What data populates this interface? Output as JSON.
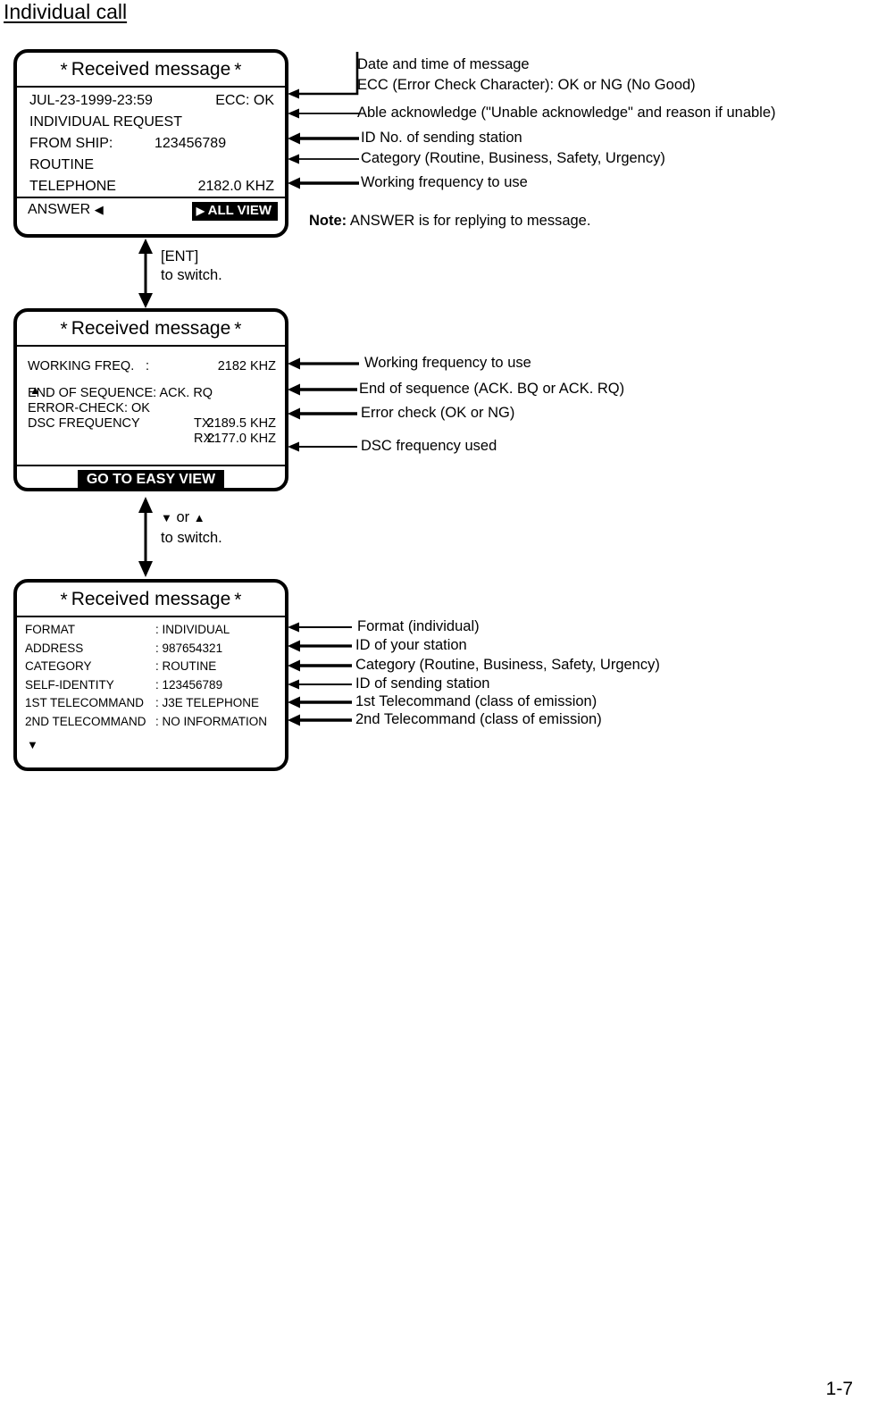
{
  "page": {
    "title": "Individual call",
    "number": "1-7"
  },
  "panels": [
    {
      "id": "easy-view",
      "title_left_star": "*",
      "title": "Received message",
      "title_right_star": "*",
      "rows": [
        {
          "left": "JUL-23-1999-23:59",
          "right": "ECC: OK"
        },
        {
          "left": "INDIVIDUAL REQUEST",
          "right": ""
        },
        {
          "left": "FROM SHIP:",
          "mid": "123456789"
        },
        {
          "left": "ROUTINE",
          "right": ""
        },
        {
          "left": "TELEPHONE",
          "right": "2182.0 KHZ"
        }
      ],
      "footer": {
        "answer_label": "ANSWER",
        "answer_arrow": "◀",
        "allview_arrow": "▶",
        "allview_label": "ALL VIEW"
      }
    },
    {
      "id": "all-view-page1",
      "title_left_star": "*",
      "title": "Received message",
      "title_right_star": "*",
      "scroll_up_indicator": "▲",
      "lines": [
        {
          "label": "WORKING FREQ.",
          "colon": ":",
          "value": "2182 KHZ"
        },
        {
          "label": "END OF SEQUENCE: ACK. RQ"
        },
        {
          "label": "ERROR-CHECK: OK"
        },
        {
          "label": "DSC FREQUENCY",
          "tx_label": "TX:",
          "tx_value": "2189.5 KHZ"
        },
        {
          "rx_label": "RX:",
          "rx_value": "2177.0 KHZ"
        }
      ],
      "footer": {
        "easyview_label": "GO TO EASY VIEW"
      }
    },
    {
      "id": "all-view-page2",
      "title_left_star": "*",
      "title": "Received message",
      "title_right_star": "*",
      "scroll_down_indicator": "▼",
      "lines": [
        {
          "label": "FORMAT",
          "value": ": INDIVIDUAL"
        },
        {
          "label": "ADDRESS",
          "value": ": 987654321"
        },
        {
          "label": "CATEGORY",
          "value": ": ROUTINE"
        },
        {
          "label": "SELF-IDENTITY",
          "value": ": 123456789"
        },
        {
          "label": "1ST TELECOMMAND",
          "value": ": J3E TELEPHONE"
        },
        {
          "label": "2ND TELECOMMAND",
          "value": ": NO INFORMATION"
        }
      ]
    }
  ],
  "connectors": [
    {
      "key_line1": "[ENT]",
      "key_line2": "to switch."
    },
    {
      "key_down": "▼",
      "key_or": "or",
      "key_up": "▲",
      "key_line2": "to switch."
    }
  ],
  "annotations": {
    "panel1": [
      "Date and time of message",
      "ECC (Error Check Character): OK or NG (No Good)",
      "Able acknowledge (\"Unable acknowledge\" and reason if unable)",
      "ID No. of sending station",
      "Category (Routine, Business, Safety, Urgency)",
      "Working frequency to use"
    ],
    "panel1_note_bold": "Note:",
    "panel1_note_rest": " ANSWER is for replying to message.",
    "panel2": [
      "Working frequency to use",
      "End of sequence (ACK. BQ or ACK. RQ)",
      "Error check (OK or NG)",
      "DSC frequency used"
    ],
    "panel3": [
      "Format (individual)",
      "ID of your station",
      "Category (Routine, Business, Safety, Urgency)",
      "ID of sending station",
      "1st Telecommand (class of emission)",
      "2nd Telecommand (class of emission)"
    ]
  },
  "colors": {
    "ink": "#000000",
    "paper": "#ffffff"
  }
}
